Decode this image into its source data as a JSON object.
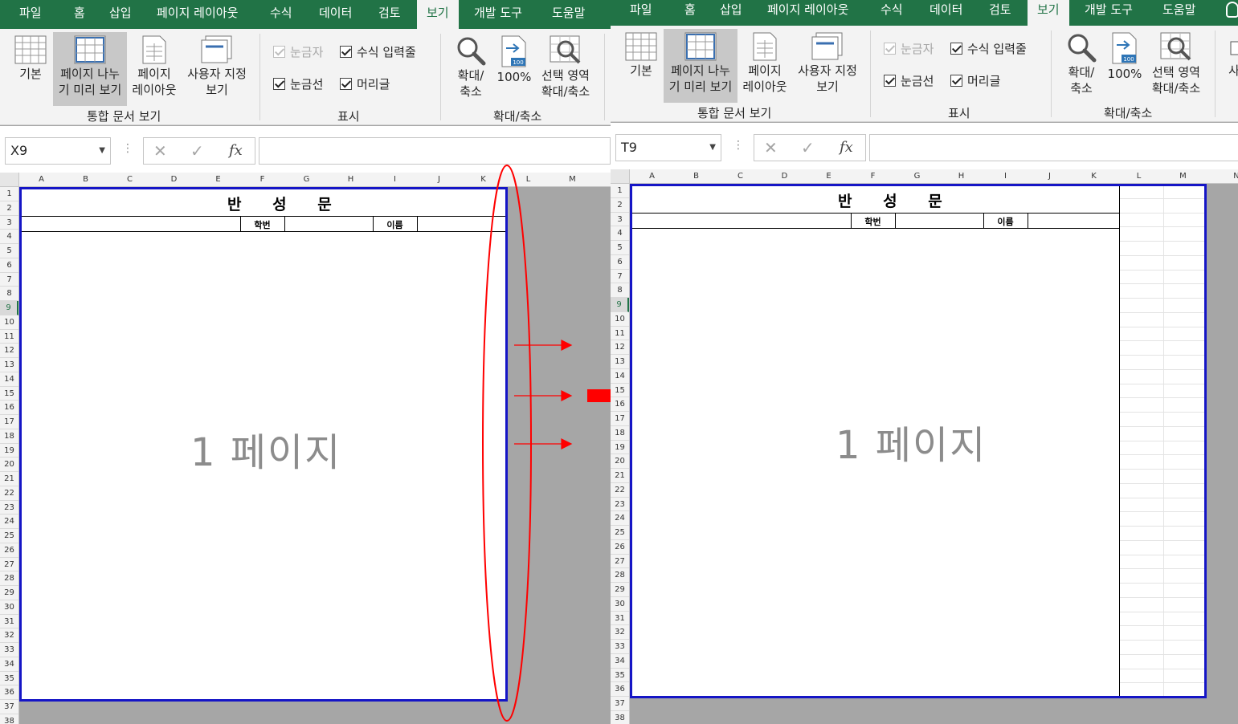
{
  "ribbon": {
    "tabs": [
      "파일",
      "홈",
      "삽입",
      "페이지 레이아웃",
      "수식",
      "데이터",
      "검토",
      "보기",
      "개발 도구",
      "도움말"
    ],
    "tabs_right_extra": "",
    "tab_right_partial": "",
    "buttons": {
      "normal": "기본",
      "page_break_1": "페이지 나누",
      "page_break_2": "기 미리 보기",
      "page_layout_1": "페이지",
      "page_layout_2": "레이아웃",
      "custom_1": "사용자 지정",
      "custom_2": "보기",
      "zoom_1": "확대/",
      "zoom_2": "축소",
      "zoom100": "100%",
      "zoom_sel_1": "선택 영역",
      "zoom_sel_2": "확대/축소",
      "partial_right": "사"
    },
    "checks": {
      "ruler": "눈금자",
      "formula_bar": "수식 입력줄",
      "gridlines": "눈금선",
      "headings": "머리글"
    },
    "groups": {
      "views": "통합 문서 보기",
      "show": "표시",
      "zoom": "확대/축소"
    }
  },
  "left": {
    "name_box": "X9"
  },
  "right": {
    "name_box": "T9"
  },
  "columns_left": [
    "A",
    "B",
    "C",
    "D",
    "E",
    "F",
    "G",
    "H",
    "I",
    "J",
    "K",
    "L",
    "M"
  ],
  "columns_right": [
    "A",
    "B",
    "C",
    "D",
    "E",
    "F",
    "G",
    "H",
    "I",
    "J",
    "K",
    "L",
    "M",
    "N"
  ],
  "rows": [
    "1",
    "2",
    "3",
    "4",
    "5",
    "6",
    "7",
    "8",
    "9",
    "10",
    "11",
    "12",
    "13",
    "14",
    "15",
    "16",
    "17",
    "18",
    "19",
    "20",
    "21",
    "22",
    "23",
    "24",
    "25",
    "26",
    "27",
    "28",
    "29",
    "30",
    "31",
    "32",
    "33",
    "34",
    "35",
    "36",
    "37",
    "38"
  ],
  "sheet": {
    "title": "반 성 문",
    "student_no_label": "학번",
    "name_label": "이름",
    "watermark": "1 페이지"
  },
  "annotation": {
    "color": "#ff0000",
    "page_border_color": "#1515c6",
    "tab_color": "#217346"
  }
}
